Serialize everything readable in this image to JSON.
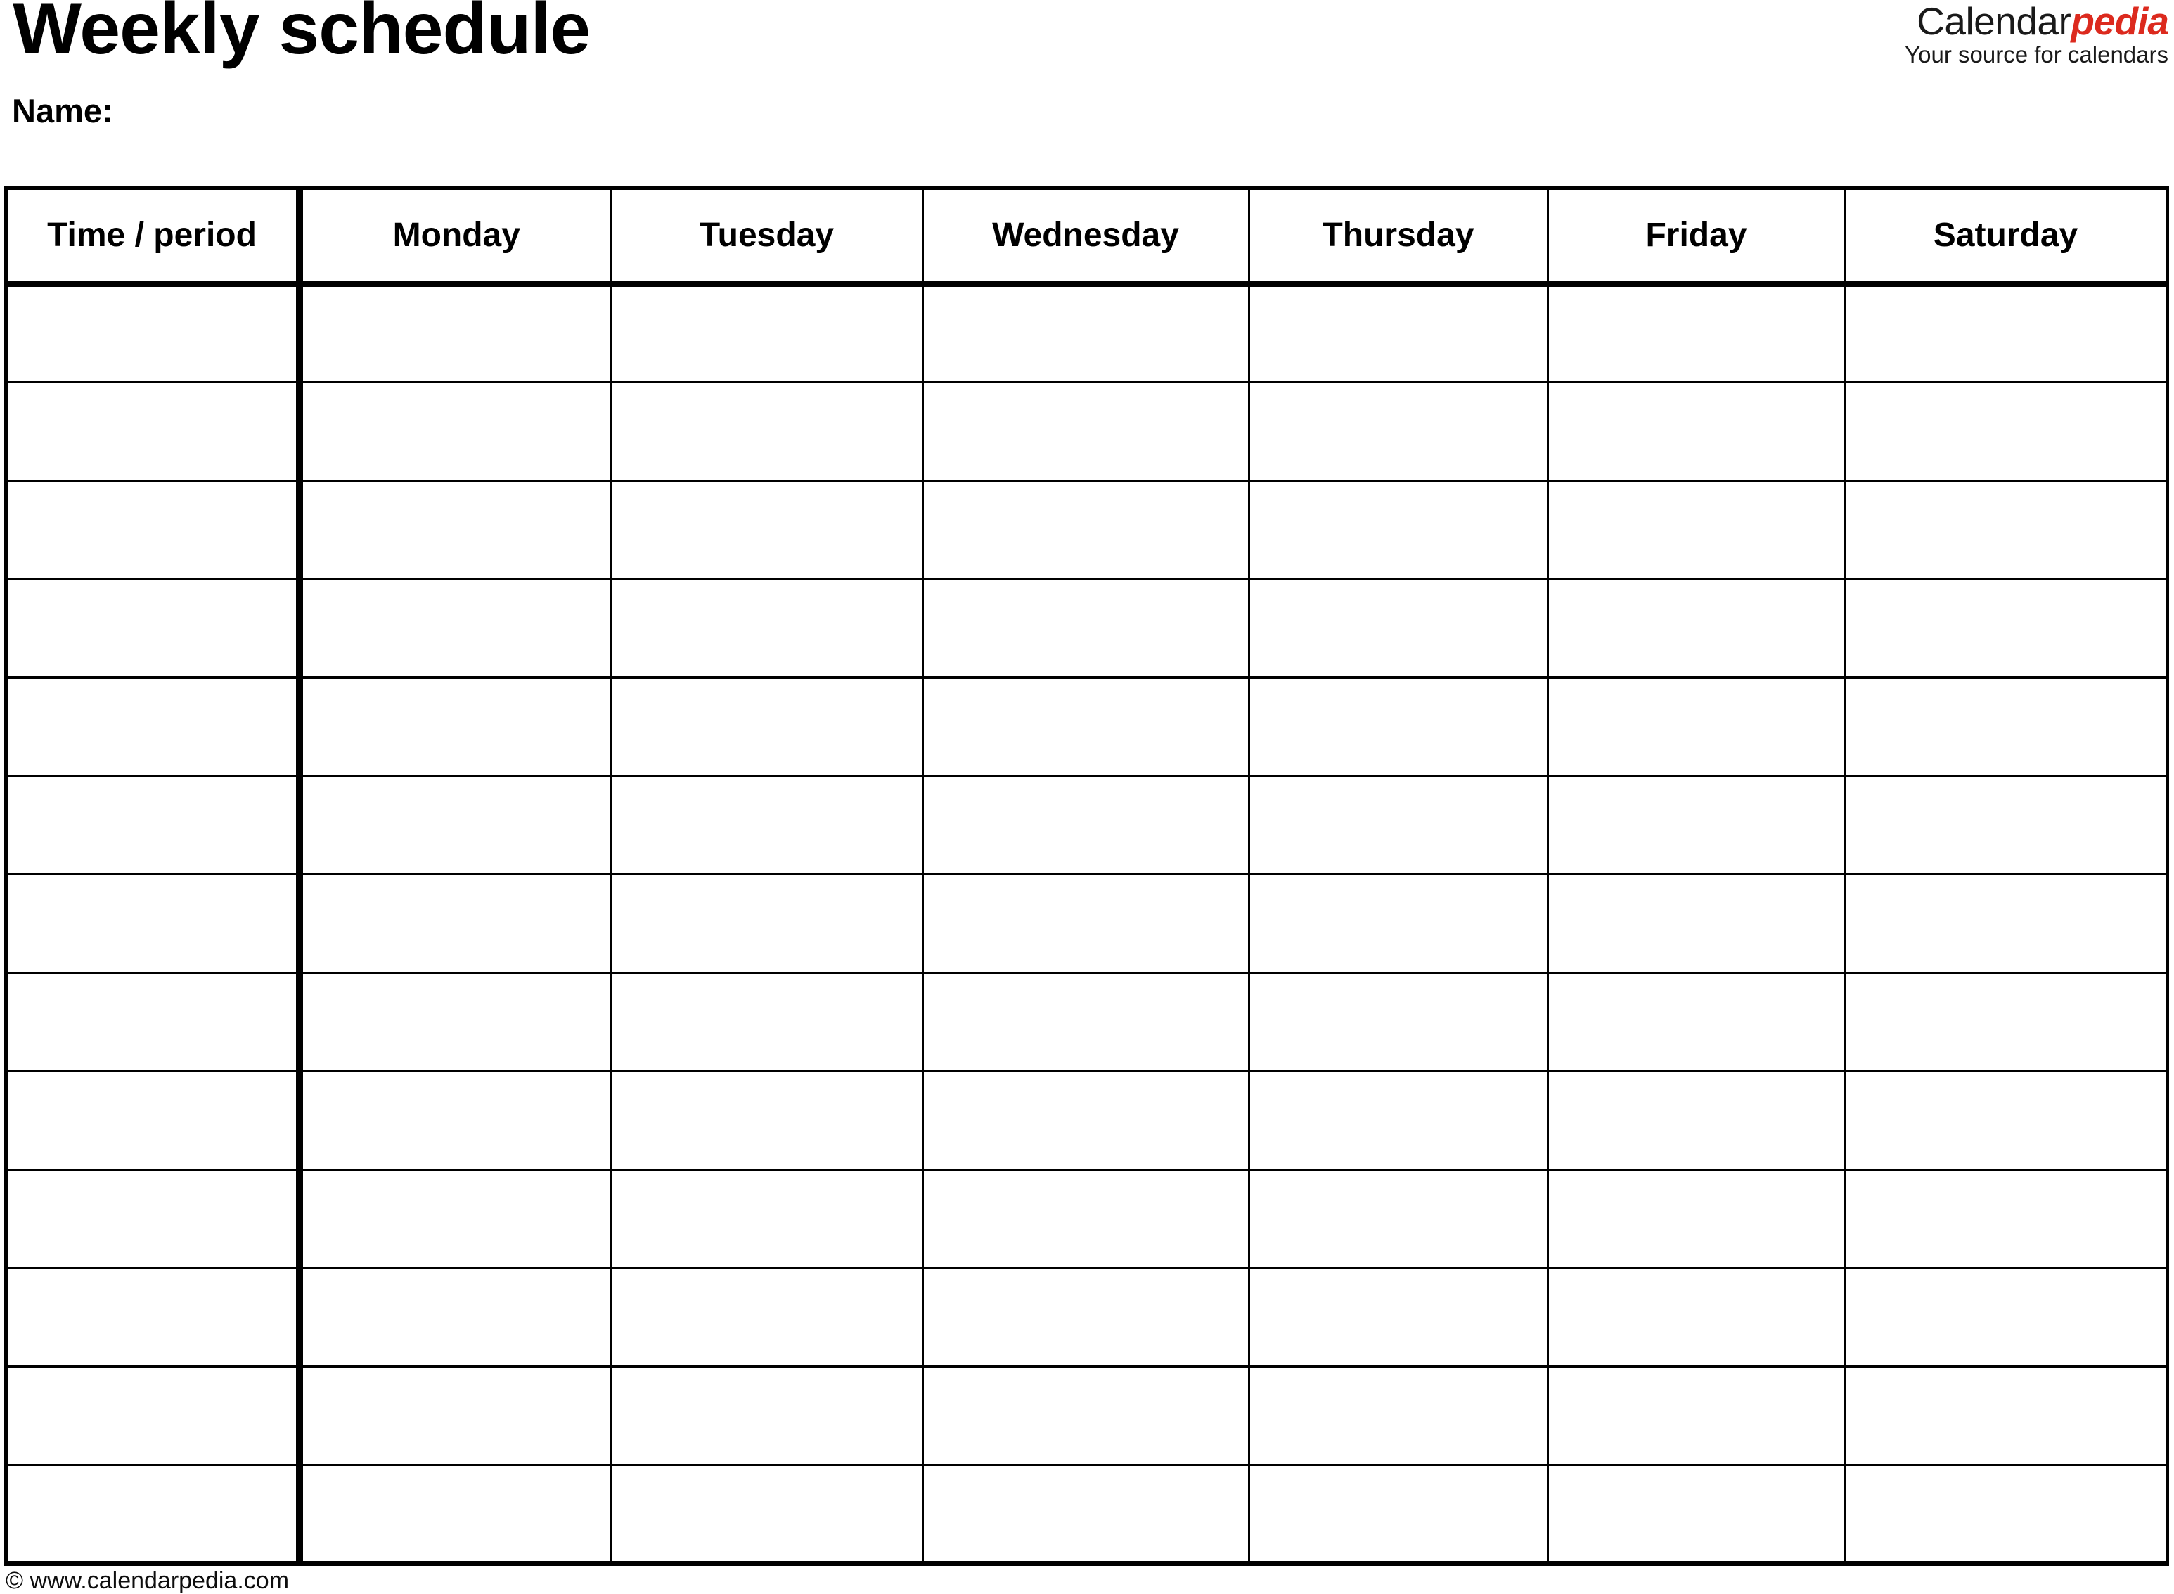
{
  "document": {
    "title": "Weekly schedule",
    "name_label": "Name:"
  },
  "brand": {
    "word_part_1": "Calendar",
    "word_part_2": "pedia",
    "tagline": "Your source for calendars",
    "accent_color": "#dc2a1e",
    "text_color": "#1a1a1a"
  },
  "table": {
    "columns": [
      {
        "key": "time",
        "label": "Time / period"
      },
      {
        "key": "monday",
        "label": "Monday"
      },
      {
        "key": "tuesday",
        "label": "Tuesday"
      },
      {
        "key": "wednesday",
        "label": "Wednesday"
      },
      {
        "key": "thursday",
        "label": "Thursday"
      },
      {
        "key": "friday",
        "label": "Friday"
      },
      {
        "key": "saturday",
        "label": "Saturday"
      }
    ],
    "row_count": 13,
    "rows": [
      {
        "time": "",
        "monday": "",
        "tuesday": "",
        "wednesday": "",
        "thursday": "",
        "friday": "",
        "saturday": ""
      },
      {
        "time": "",
        "monday": "",
        "tuesday": "",
        "wednesday": "",
        "thursday": "",
        "friday": "",
        "saturday": ""
      },
      {
        "time": "",
        "monday": "",
        "tuesday": "",
        "wednesday": "",
        "thursday": "",
        "friday": "",
        "saturday": ""
      },
      {
        "time": "",
        "monday": "",
        "tuesday": "",
        "wednesday": "",
        "thursday": "",
        "friday": "",
        "saturday": ""
      },
      {
        "time": "",
        "monday": "",
        "tuesday": "",
        "wednesday": "",
        "thursday": "",
        "friday": "",
        "saturday": ""
      },
      {
        "time": "",
        "monday": "",
        "tuesday": "",
        "wednesday": "",
        "thursday": "",
        "friday": "",
        "saturday": ""
      },
      {
        "time": "",
        "monday": "",
        "tuesday": "",
        "wednesday": "",
        "thursday": "",
        "friday": "",
        "saturday": ""
      },
      {
        "time": "",
        "monday": "",
        "tuesday": "",
        "wednesday": "",
        "thursday": "",
        "friday": "",
        "saturday": ""
      },
      {
        "time": "",
        "monday": "",
        "tuesday": "",
        "wednesday": "",
        "thursday": "",
        "friday": "",
        "saturday": ""
      },
      {
        "time": "",
        "monday": "",
        "tuesday": "",
        "wednesday": "",
        "thursday": "",
        "friday": "",
        "saturday": ""
      },
      {
        "time": "",
        "monday": "",
        "tuesday": "",
        "wednesday": "",
        "thursday": "",
        "friday": "",
        "saturday": ""
      },
      {
        "time": "",
        "monday": "",
        "tuesday": "",
        "wednesday": "",
        "thursday": "",
        "friday": "",
        "saturday": ""
      },
      {
        "time": "",
        "monday": "",
        "tuesday": "",
        "wednesday": "",
        "thursday": "",
        "friday": "",
        "saturday": ""
      }
    ]
  },
  "footer": {
    "copyright": "© www.calendarpedia.com"
  }
}
